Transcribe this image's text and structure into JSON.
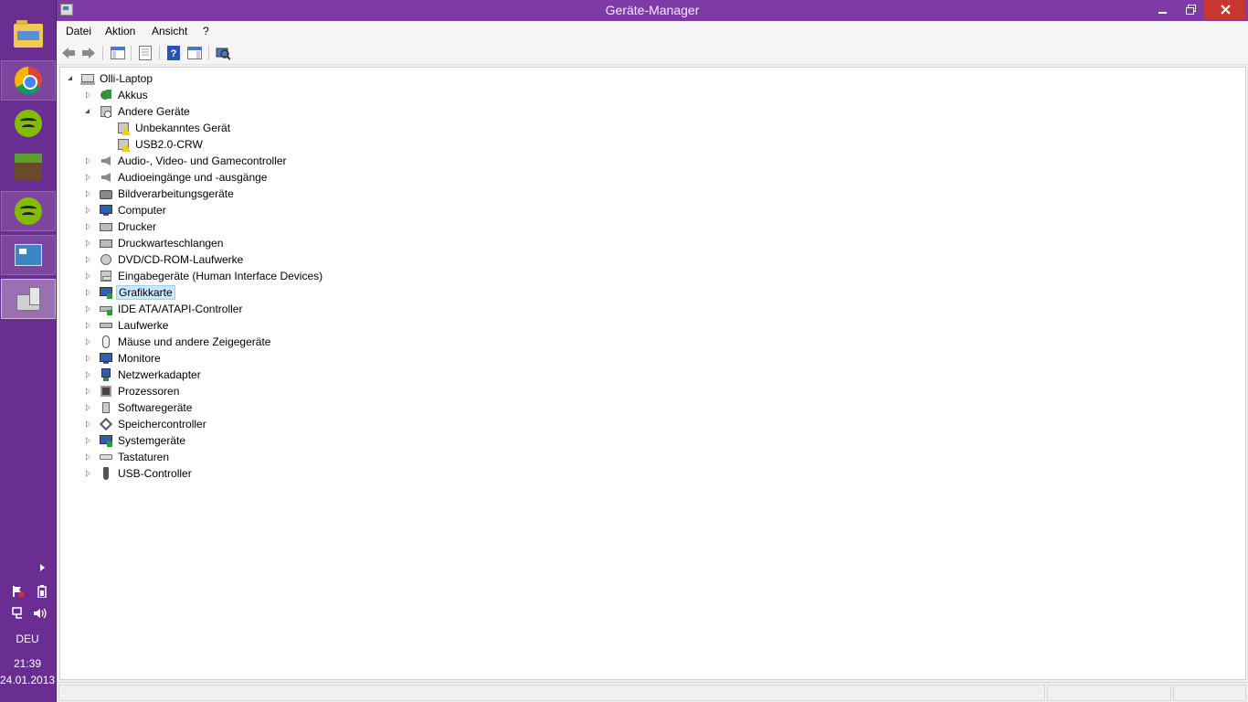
{
  "window": {
    "title": "Geräte-Manager"
  },
  "menu": {
    "items": [
      "Datei",
      "Aktion",
      "Ansicht",
      "?"
    ]
  },
  "toolbar": {
    "buttons": [
      "back-icon",
      "forward-icon",
      "console-tree-icon",
      "properties-icon",
      "help-icon",
      "action-pane-icon",
      "scan-hardware-icon"
    ]
  },
  "tree": {
    "root": "Olli-Laptop",
    "nodes": [
      {
        "label": "Akkus",
        "icon": "battery-icon",
        "state": "collapsed"
      },
      {
        "label": "Andere Geräte",
        "icon": "unknown-device-icon",
        "state": "expanded",
        "children": [
          {
            "label": "Unbekanntes Gerät",
            "icon": "warning-device-icon"
          },
          {
            "label": "USB2.0-CRW",
            "icon": "warning-device-icon"
          }
        ]
      },
      {
        "label": "Audio-, Video- und Gamecontroller",
        "icon": "speaker-icon",
        "state": "collapsed"
      },
      {
        "label": "Audioeingänge und -ausgänge",
        "icon": "speaker-icon",
        "state": "collapsed"
      },
      {
        "label": "Bildverarbeitungsgeräte",
        "icon": "camera-icon",
        "state": "collapsed"
      },
      {
        "label": "Computer",
        "icon": "computer-icon",
        "state": "collapsed"
      },
      {
        "label": "Drucker",
        "icon": "printer-icon",
        "state": "collapsed"
      },
      {
        "label": "Druckwarteschlangen",
        "icon": "printer-icon",
        "state": "collapsed"
      },
      {
        "label": "DVD/CD-ROM-Laufwerke",
        "icon": "disc-icon",
        "state": "collapsed"
      },
      {
        "label": "Eingabegeräte (Human Interface Devices)",
        "icon": "hid-icon",
        "state": "collapsed"
      },
      {
        "label": "Grafikkarte",
        "icon": "display-adapter-icon",
        "state": "collapsed",
        "selected": true
      },
      {
        "label": "IDE ATA/ATAPI-Controller",
        "icon": "ide-controller-icon",
        "state": "collapsed"
      },
      {
        "label": "Laufwerke",
        "icon": "drive-icon",
        "state": "collapsed"
      },
      {
        "label": "Mäuse und andere Zeigegeräte",
        "icon": "mouse-icon",
        "state": "collapsed"
      },
      {
        "label": "Monitore",
        "icon": "monitor-icon",
        "state": "collapsed"
      },
      {
        "label": "Netzwerkadapter",
        "icon": "network-adapter-icon",
        "state": "collapsed"
      },
      {
        "label": "Prozessoren",
        "icon": "processor-icon",
        "state": "collapsed"
      },
      {
        "label": "Softwaregeräte",
        "icon": "software-device-icon",
        "state": "collapsed"
      },
      {
        "label": "Speichercontroller",
        "icon": "storage-controller-icon",
        "state": "collapsed"
      },
      {
        "label": "Systemgeräte",
        "icon": "system-device-icon",
        "state": "collapsed"
      },
      {
        "label": "Tastaturen",
        "icon": "keyboard-icon",
        "state": "collapsed"
      },
      {
        "label": "USB-Controller",
        "icon": "usb-icon",
        "state": "collapsed"
      }
    ]
  },
  "taskbar": {
    "apps": [
      "file-explorer-icon",
      "chrome-icon",
      "spotify-icon",
      "minecraft-icon",
      "spotify-icon",
      "control-panel-icon",
      "device-manager-icon"
    ],
    "tray": {
      "icons": [
        "action-center-icon",
        "battery-icon",
        "network-icon",
        "volume-icon"
      ],
      "language": "DEU",
      "time": "21:39",
      "date": "24.01.2013"
    }
  },
  "colors": {
    "accent": "#7e3aa6",
    "taskbar": "#6a2d91",
    "close": "#c7372f",
    "selection": "#cce8ff"
  }
}
